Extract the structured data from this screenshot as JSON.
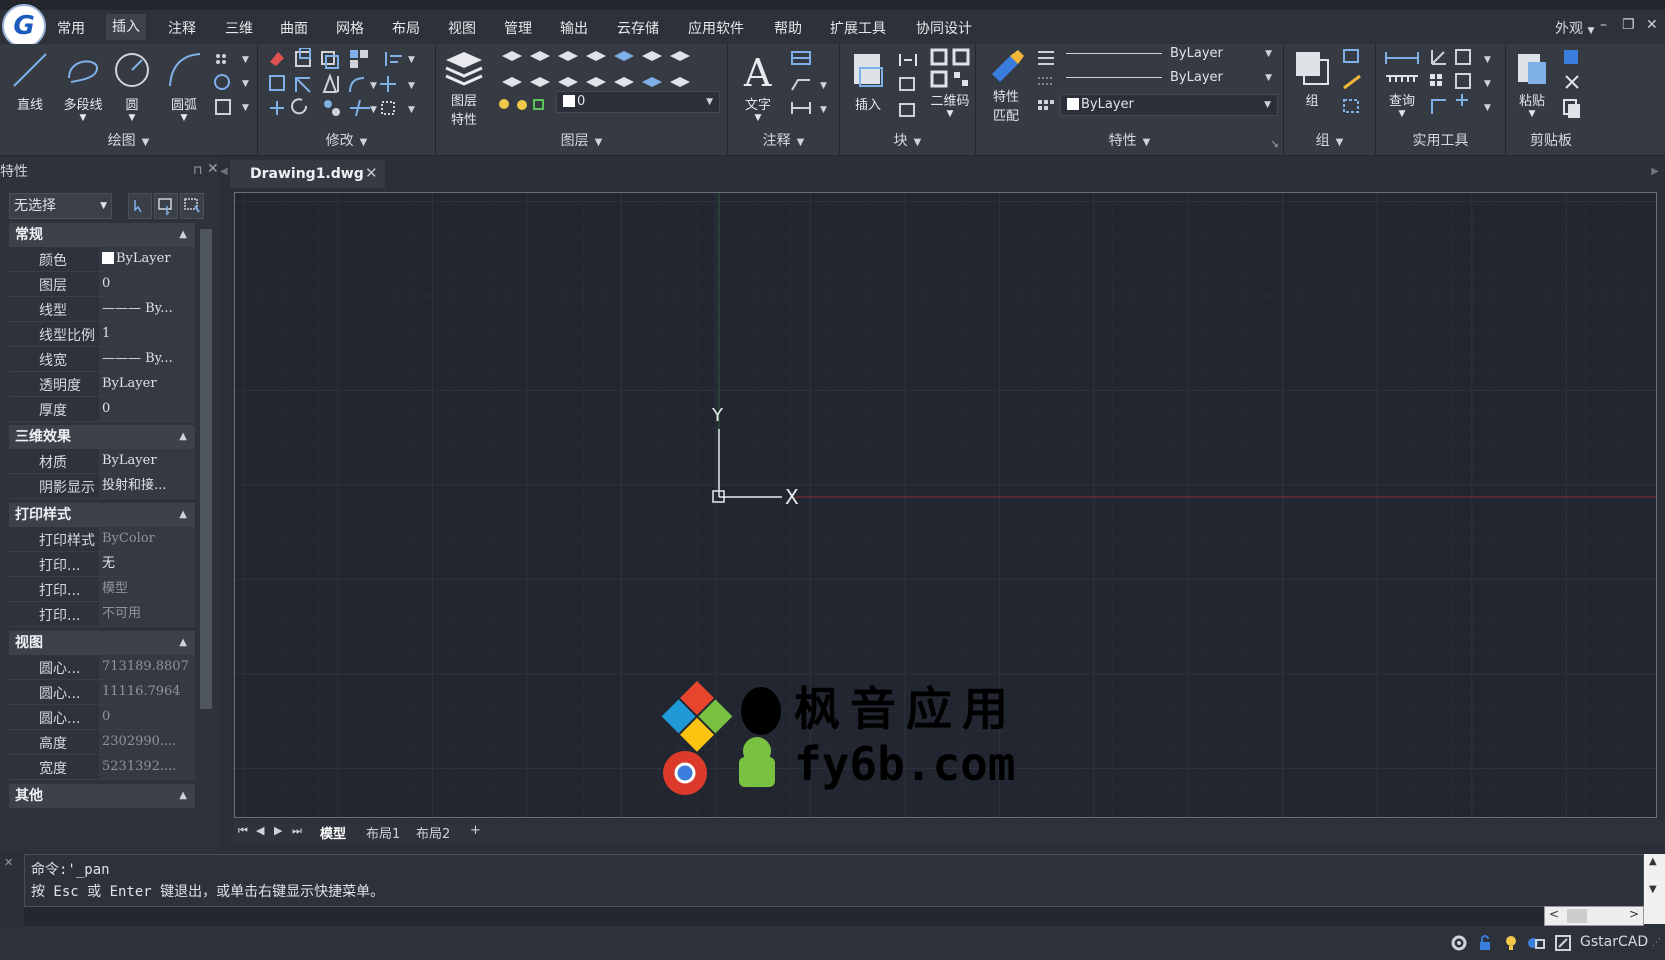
{
  "menu": {
    "tabs": [
      "常用",
      "插入",
      "注释",
      "三维",
      "曲面",
      "网格",
      "布局",
      "视图",
      "管理",
      "输出",
      "云存储",
      "应用软件",
      "帮助",
      "扩展工具",
      "协同设计"
    ],
    "active_tab": "插入",
    "appearance": "外观"
  },
  "ribbon": {
    "draw": {
      "title": "绘图",
      "line": "直线",
      "polyline": "多段线",
      "circle": "圆",
      "arc": "圆弧"
    },
    "modify": {
      "title": "修改"
    },
    "layers": {
      "title": "图层",
      "layer_props_line1": "图层",
      "layer_props_line2": "特性",
      "current_layer": "0"
    },
    "annotation": {
      "title": "注释",
      "text": "文字"
    },
    "block": {
      "title": "块",
      "insert": "插入",
      "qrcode": "二维码"
    },
    "properties": {
      "title": "特性",
      "match_line1": "特性",
      "match_line2": "匹配",
      "linetype": "ByLayer",
      "lineweight": "ByLayer",
      "color": "ByLayer"
    },
    "group": {
      "title": "组",
      "group": "组"
    },
    "utilities": {
      "title": "实用工具",
      "query": "查询"
    },
    "clipboard": {
      "title": "剪贴板",
      "paste": "粘贴"
    }
  },
  "properties_panel": {
    "title": "特性",
    "selection": "无选择",
    "sections": {
      "general": {
        "title": "常规",
        "rows": [
          {
            "k": "颜色",
            "v": "ByLayer"
          },
          {
            "k": "图层",
            "v": "0"
          },
          {
            "k": "线型",
            "v": "——— By..."
          },
          {
            "k": "线型比例",
            "v": "1"
          },
          {
            "k": "线宽",
            "v": "——— By..."
          },
          {
            "k": "透明度",
            "v": "ByLayer"
          },
          {
            "k": "厚度",
            "v": "0"
          }
        ]
      },
      "effects3d": {
        "title": "三维效果",
        "rows": [
          {
            "k": "材质",
            "v": "ByLayer"
          },
          {
            "k": "阴影显示",
            "v": "投射和接..."
          }
        ]
      },
      "plotstyle": {
        "title": "打印样式",
        "rows": [
          {
            "k": "打印样式",
            "v": "ByColor"
          },
          {
            "k": "打印...",
            "v": "无"
          },
          {
            "k": "打印...",
            "v": "模型"
          },
          {
            "k": "打印...",
            "v": "不可用"
          }
        ]
      },
      "view": {
        "title": "视图",
        "rows": [
          {
            "k": "圆心...",
            "v": "713189.8807"
          },
          {
            "k": "圆心...",
            "v": "11116.7964"
          },
          {
            "k": "圆心...",
            "v": "0"
          },
          {
            "k": "高度",
            "v": "2302990...."
          },
          {
            "k": "宽度",
            "v": "5231392...."
          }
        ]
      },
      "other": {
        "title": "其他"
      }
    }
  },
  "document": {
    "tab_label": "Drawing1.dwg"
  },
  "canvas": {
    "ucs_x": "X",
    "ucs_y": "Y"
  },
  "layout_tabs": [
    "模型",
    "布局1",
    "布局2",
    "+"
  ],
  "command": {
    "line1": "命令:'_pan",
    "line2": "按 Esc 或 Enter 键退出，或单击右键显示快捷菜单。"
  },
  "statusbar": {
    "app_name": "GstarCAD"
  },
  "watermark": {
    "line1": "枫音应用",
    "line2": "fy6b.com"
  },
  "colors": {
    "accent": "#1b5bbd",
    "x_axis": "#8a2b33",
    "y_axis": "#2f5a3a",
    "canvas_bg": "#212630"
  }
}
